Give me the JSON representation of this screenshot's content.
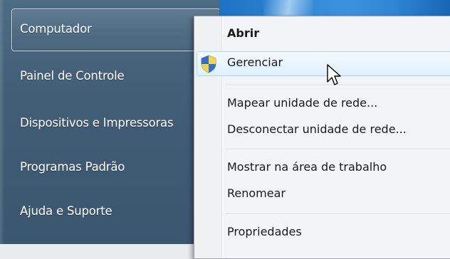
{
  "start_menu": {
    "items": [
      {
        "label": "Computador"
      },
      {
        "label": "Painel de Controle"
      },
      {
        "label": "Dispositivos e Impressoras"
      },
      {
        "label": "Programas Padrão"
      },
      {
        "label": "Ajuda e Suporte"
      }
    ],
    "selected_index": 0
  },
  "context_menu": {
    "items": [
      {
        "label": "Abrir",
        "default": true
      },
      {
        "label": "Gerenciar",
        "icon": "uac-shield-icon",
        "hovered": true
      },
      {
        "label": "Mapear unidade de rede..."
      },
      {
        "label": "Desconectar unidade de rede..."
      },
      {
        "label": "Mostrar na área de trabalho"
      },
      {
        "label": "Renomear"
      },
      {
        "label": "Propriedades"
      }
    ]
  },
  "cursor": {
    "icon": "arrow-cursor-icon"
  }
}
